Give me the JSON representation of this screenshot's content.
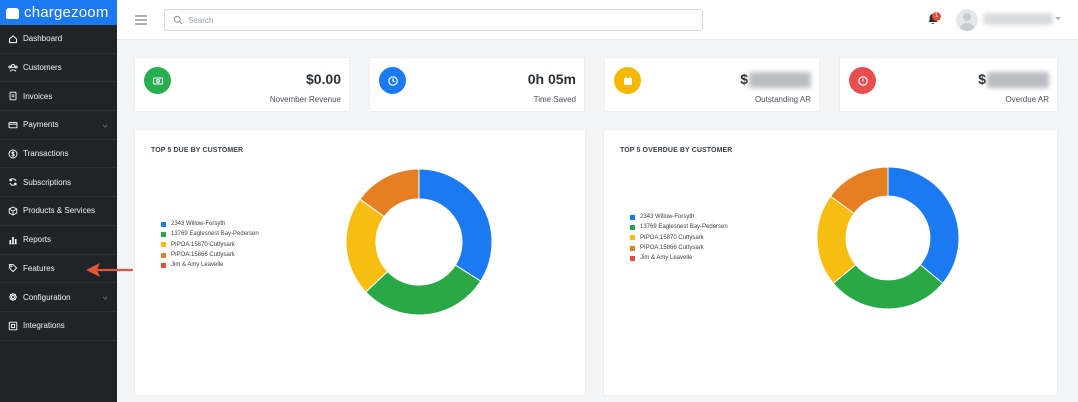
{
  "app": {
    "logo_text": "chargezoom",
    "brand_color": "#1b7af1"
  },
  "sidebar": {
    "items": [
      {
        "label": "Dashboard",
        "icon": "home-icon",
        "has_children": false
      },
      {
        "label": "Customers",
        "icon": "users-icon",
        "has_children": false
      },
      {
        "label": "Invoices",
        "icon": "invoice-icon",
        "has_children": false
      },
      {
        "label": "Payments",
        "icon": "payment-icon",
        "has_children": true
      },
      {
        "label": "Transactions",
        "icon": "dollar-icon",
        "has_children": false
      },
      {
        "label": "Subscriptions",
        "icon": "refresh-icon",
        "has_children": false
      },
      {
        "label": "Products & Services",
        "icon": "box-icon",
        "has_children": false
      },
      {
        "label": "Reports",
        "icon": "bar-chart-icon",
        "has_children": false
      },
      {
        "label": "Features",
        "icon": "tag-icon",
        "has_children": false
      },
      {
        "label": "Configuration",
        "icon": "gear-icon",
        "has_children": true
      },
      {
        "label": "Integrations",
        "icon": "grid-icon",
        "has_children": false
      }
    ]
  },
  "topbar": {
    "search_placeholder": "Search",
    "notification_count": "1"
  },
  "stats": [
    {
      "value": "$0.00",
      "label": "November Revenue",
      "icon": "money-icon",
      "color": "#27ae4f"
    },
    {
      "value": "0h 05m",
      "label": "Time Saved",
      "icon": "clock-icon",
      "color": "#1b7af1"
    },
    {
      "value": "$",
      "label": "Outstanding AR",
      "icon": "calendar-icon",
      "color": "#f5b800",
      "value_obscured": true
    },
    {
      "value": "$",
      "label": "Overdue AR",
      "icon": "alert-icon",
      "color": "#e94e4e",
      "value_obscured": true
    }
  ],
  "panels": [
    {
      "title": "TOP 5 DUE BY CUSTOMER"
    },
    {
      "title": "TOP 5 OVERDUE BY CUSTOMER"
    }
  ],
  "chart_data": [
    {
      "type": "pie",
      "title": "TOP 5 DUE BY CUSTOMER",
      "donut": true,
      "legend_placement": "left",
      "categories": [
        "2343 Willow-Forsyth",
        "13769 Eaglesnest Bay-Pedersen",
        "PIPOA:15870 Cuttysark",
        "PIPOA:15866 Cuttysark",
        "Jim & Amy Leavelle"
      ],
      "values": [
        34,
        29,
        22,
        15,
        0
      ],
      "colors": [
        "#1b7af1",
        "#2aa845",
        "#f7bd10",
        "#e67e22",
        "#e74c3c"
      ]
    },
    {
      "type": "pie",
      "title": "TOP 5 OVERDUE BY CUSTOMER",
      "donut": true,
      "legend_placement": "left",
      "categories": [
        "2343 Willow-Forsyth",
        "13769 Eaglesnest Bay-Pedersen",
        "PIPOA:15870 Cuttysark",
        "PIPOA:15866 Cuttysark",
        "Jim & Amy Leavelle"
      ],
      "values": [
        36,
        28,
        21,
        15,
        0
      ],
      "colors": [
        "#1b7af1",
        "#2aa845",
        "#f7bd10",
        "#e67e22",
        "#e74c3c"
      ]
    }
  ]
}
